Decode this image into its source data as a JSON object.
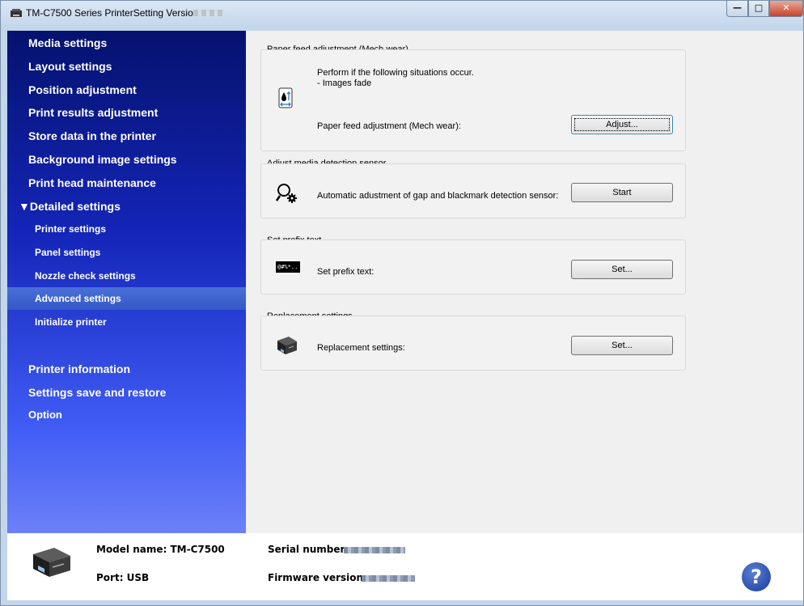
{
  "window": {
    "title": "TM-C7500 Series PrinterSetting Version",
    "controls": {
      "minimize": "—",
      "maximize": "□",
      "close": "✕"
    }
  },
  "sidebar": {
    "items": [
      {
        "label": "Media settings",
        "level": "main"
      },
      {
        "label": "Layout settings",
        "level": "main"
      },
      {
        "label": "Position adjustment",
        "level": "main"
      },
      {
        "label": "Print results adjustment",
        "level": "main"
      },
      {
        "label": "Store data in the printer",
        "level": "main"
      },
      {
        "label": "Background image settings",
        "level": "main"
      },
      {
        "label": "Print head maintenance",
        "level": "main"
      },
      {
        "label": "▼Detailed settings",
        "level": "main"
      },
      {
        "label": "Printer settings",
        "level": "sub"
      },
      {
        "label": "Panel settings",
        "level": "sub"
      },
      {
        "label": "Nozzle check settings",
        "level": "sub"
      },
      {
        "label": "Advanced settings",
        "level": "sub",
        "selected": true
      },
      {
        "label": "Initialize printer",
        "level": "sub"
      },
      {
        "label": "Printer information",
        "level": "main"
      },
      {
        "label": "Settings save and restore",
        "level": "main"
      },
      {
        "label": "Option",
        "level": "sub"
      }
    ]
  },
  "groups": {
    "paper_feed": {
      "title": "Paper feed adjustment (Mech wear)",
      "description_line1": "Perform if the following situations occur.",
      "description_line2": "- Images fade",
      "label": "Paper feed adjustment (Mech wear):",
      "button": "Adjust...",
      "icon": "paper-feed-icon"
    },
    "media_sensor": {
      "title": "Adjust media detection sensor",
      "label": "Automatic adustment of gap and blackmark detection sensor:",
      "button": "Start",
      "icon": "sensor-gear-icon"
    },
    "prefix": {
      "title": "Set prefix text",
      "label": "Set prefix text:",
      "button": "Set...",
      "icon_text": "@#%*..",
      "icon": "prefix-text-icon"
    },
    "replacement": {
      "title": "Replacement settings",
      "label": "Replacement settings:",
      "button": "Set...",
      "icon": "printer-replacement-icon"
    }
  },
  "footer": {
    "model": "Model name: TM-C7500",
    "port": "Port: USB",
    "serial_label": "Serial number:",
    "firmware_label": "Firmware version:",
    "help": "?"
  },
  "colors": {
    "sidebar_top": "#05126e",
    "sidebar_bottom": "#6b80f8",
    "selected_item": "#3458c8",
    "help_button": "#1a3a9e"
  }
}
